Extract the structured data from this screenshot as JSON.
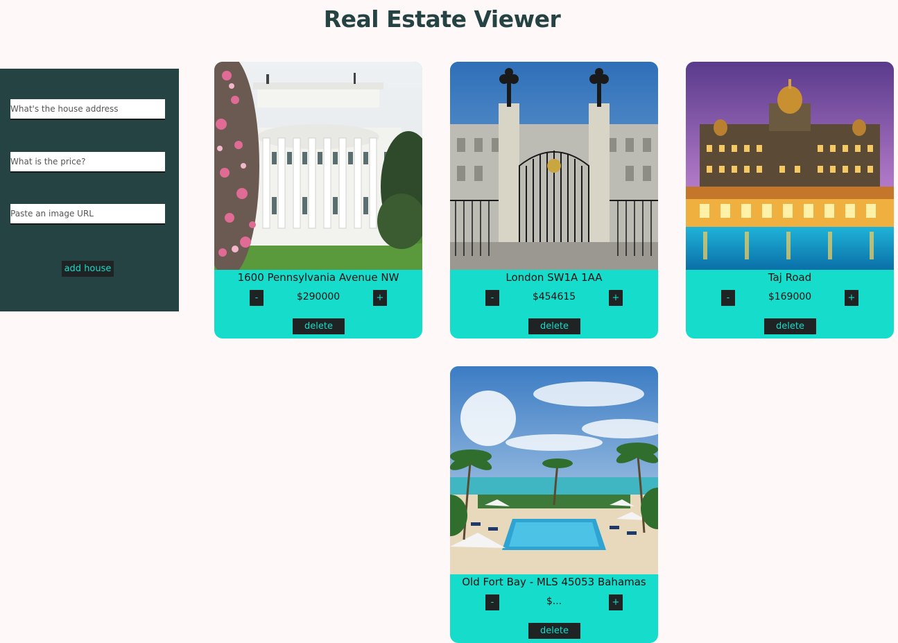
{
  "app": {
    "title": "Real Estate Viewer"
  },
  "form": {
    "address_placeholder": "What's the house address",
    "price_placeholder": "What is the price?",
    "image_placeholder": "Paste an image URL",
    "add_label": "add house"
  },
  "colors": {
    "panel": "#264343",
    "accent": "#16dccb",
    "button": "#1f2323",
    "background": "#fff8f8"
  },
  "houses": [
    {
      "address": "1600 Pennsylvania Avenue NW",
      "price": "$290000",
      "image_icon": "white-house-photo",
      "minus": "-",
      "plus": "+",
      "delete": "delete"
    },
    {
      "address": "London SW1A 1AA",
      "price": "$454615",
      "image_icon": "palace-gate-photo",
      "minus": "-",
      "plus": "+",
      "delete": "delete"
    },
    {
      "address": "Taj Road",
      "price": "$169000",
      "image_icon": "palace-hotel-photo",
      "minus": "-",
      "plus": "+",
      "delete": "delete"
    },
    {
      "address": "Old Fort Bay - MLS 45053 Bahamas",
      "price": "$...",
      "image_icon": "beach-villa-photo",
      "minus": "-",
      "plus": "+",
      "delete": "delete"
    }
  ]
}
